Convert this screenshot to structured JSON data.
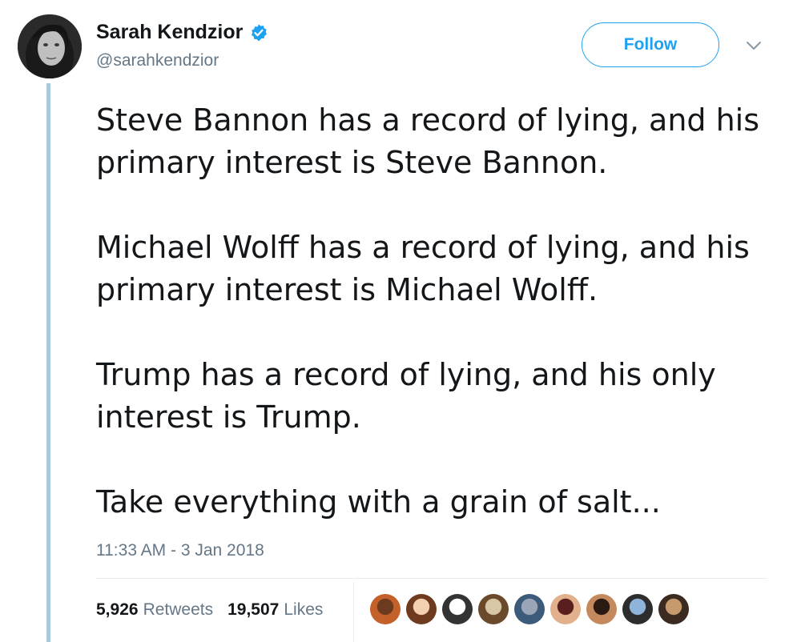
{
  "user": {
    "name": "Sarah Kendzior",
    "handle": "@sarahkendzior",
    "avatar_icon": "profile-photo",
    "verified_icon": "verified-badge-icon",
    "verified_color": "#1da1f2"
  },
  "actions": {
    "follow_label": "Follow",
    "menu_icon": "chevron-down-icon"
  },
  "tweet": {
    "paragraphs": [
      "Steve Bannon has a record of lying, and his primary interest is Steve Bannon.",
      "Michael Wolff has a record of lying, and his primary interest is Michael Wolff.",
      "Trump has a record of lying, and his only interest is Trump.",
      "Take everything with a grain of salt..."
    ],
    "timestamp": "11:33 AM - 3 Jan 2018"
  },
  "stats": {
    "retweets_count": "5,926",
    "retweets_label": "Retweets",
    "likes_count": "19,507",
    "likes_label": "Likes"
  },
  "likers": [
    {
      "colors": [
        "#6b3a1f",
        "#c4612a"
      ]
    },
    {
      "colors": [
        "#f3d1b0",
        "#6e3b1e"
      ]
    },
    {
      "colors": [
        "#ffffff",
        "#333333"
      ]
    },
    {
      "colors": [
        "#d8c7a6",
        "#6a4a2a"
      ]
    },
    {
      "colors": [
        "#9aa6b8",
        "#3c5a7a"
      ]
    },
    {
      "colors": [
        "#5a1e1e",
        "#e2b08c"
      ]
    },
    {
      "colors": [
        "#2a1a12",
        "#c48a5e"
      ]
    },
    {
      "colors": [
        "#8fb3d9",
        "#2d2d2d"
      ]
    },
    {
      "colors": [
        "#c79a6e",
        "#3a2a20"
      ]
    }
  ],
  "theme": {
    "accent": "#1da1f2",
    "muted_text": "#657786",
    "thread_line": "#a9c9dc"
  }
}
